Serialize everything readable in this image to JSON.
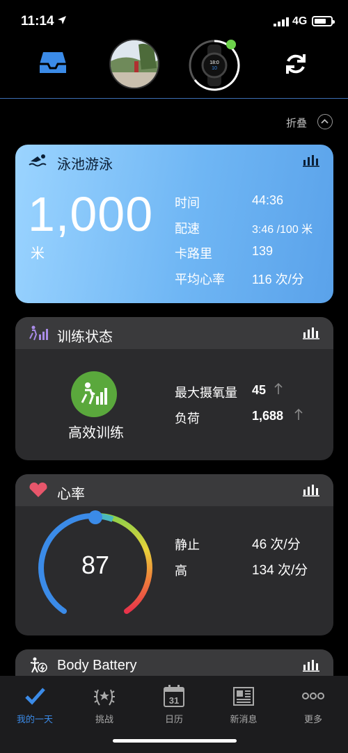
{
  "status": {
    "time": "11:14",
    "network": "4G"
  },
  "header": {
    "collapse_label": "折叠"
  },
  "swim_card": {
    "title": "泳池游泳",
    "distance": "1,000",
    "distance_unit": "米",
    "stats": [
      {
        "label": "时间",
        "value": "44:36"
      },
      {
        "label": "配速",
        "value": "3:46 /100 米"
      },
      {
        "label": "卡路里",
        "value": "139"
      },
      {
        "label": "平均心率",
        "value": "116 次/分"
      }
    ]
  },
  "training_card": {
    "title": "训练状态",
    "status_label": "高效训练",
    "stats": [
      {
        "label": "最大摄氧量",
        "value": "45"
      },
      {
        "label": "负荷",
        "value": "1,688"
      }
    ]
  },
  "heart_card": {
    "title": "心率",
    "current": "87",
    "stats": [
      {
        "label": "静止",
        "value": "46 次/分"
      },
      {
        "label": "高",
        "value": "134 次/分"
      }
    ]
  },
  "battery_card": {
    "title": "Body Battery"
  },
  "tabs": [
    {
      "label": "我的一天",
      "icon": "check-icon",
      "active": true
    },
    {
      "label": "挑战",
      "icon": "laurel-icon"
    },
    {
      "label": "日历",
      "icon": "calendar-icon",
      "day": "31"
    },
    {
      "label": "新消息",
      "icon": "newspaper-icon"
    },
    {
      "label": "更多",
      "icon": "more-icon"
    }
  ],
  "colors": {
    "accent": "#3b8be8",
    "swim_card": "#6fb6f4",
    "training_badge": "#5aa83c",
    "heart_icon": "#e8566b"
  }
}
